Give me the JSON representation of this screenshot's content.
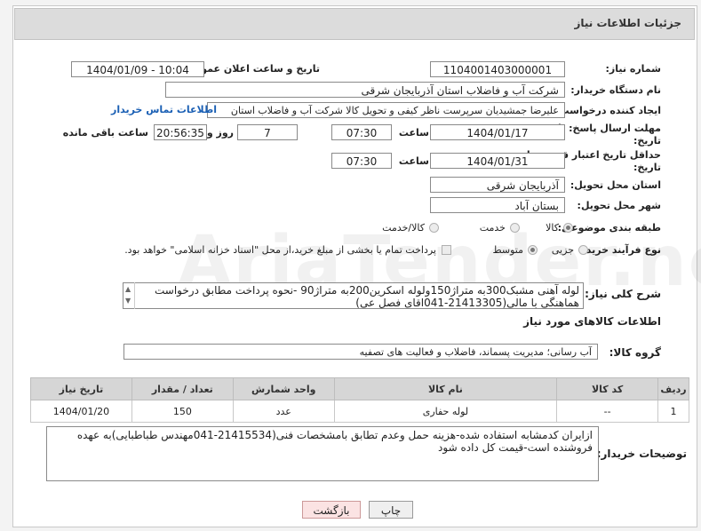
{
  "title": "جزئیات اطلاعات نیاز",
  "watermark": "AriaTender.net",
  "need_number": {
    "label": "شماره نیاز:",
    "value": "1104001403000001"
  },
  "announce": {
    "label": "تاریخ و ساعت اعلان عمومی:",
    "value": "1404/01/09 - 10:04"
  },
  "buyer_org": {
    "label": "نام دستگاه خریدار:",
    "value": "شرکت آب و فاضلاب استان آذربایجان شرقی"
  },
  "creator": {
    "label": "ایجاد کننده درخواست:",
    "value": "علیرضا جمشیدیان سرپرست ناظر کیفی و تحویل کالا شرکت آب و فاضلاب استان",
    "contact_link": "اطلاعات تماس خریدار"
  },
  "deadline": {
    "label_1": "مهلت ارسال پاسخ: تا",
    "label_2": "تاریخ:",
    "date": "1404/01/17",
    "time_label": "ساعت",
    "time": "07:30",
    "days": "7",
    "days_label": "روز و",
    "remaining": "20:56:35",
    "remaining_label": "ساعت باقی مانده"
  },
  "validity": {
    "label_1": "حداقل تاریخ اعتبار قیمت: تا",
    "label_2": "تاریخ:",
    "date": "1404/01/31",
    "time_label": "ساعت",
    "time": "07:30"
  },
  "province": {
    "label": "استان محل تحویل:",
    "value": "آذربایجان شرقی"
  },
  "city": {
    "label": "شهر محل تحویل:",
    "value": "بستان آباد"
  },
  "category": {
    "label": "طبقه بندی موضوعی:",
    "options": [
      "کالا",
      "خدمت",
      "کالا/خدمت"
    ],
    "selected": "کالا"
  },
  "process": {
    "label": "نوع فرآیند خرید :",
    "options": [
      "جزیی",
      "متوسط"
    ],
    "selected": "متوسط",
    "note": "پرداخت تمام یا بخشی از مبلغ خرید،از محل \"اسناد خزانه اسلامی\" خواهد بود."
  },
  "general_desc": {
    "label": "شرح کلی نیاز:",
    "value": "لوله آهنی مشبک300به متراژ150ولوله اسکرین200به متراژ90 -نحوه پرداخت مطابق درخواست هماهنگی با مالی(21413305-041اقای فصل عی)"
  },
  "goods_info_title": "اطلاعات کالاهای مورد نیاز",
  "goods_group": {
    "label": "گروه کالا:",
    "value": "آب رسانی؛ مدیریت پسماند، فاضلاب و فعالیت های تصفیه"
  },
  "table": {
    "headers": [
      "ردیف",
      "کد کالا",
      "نام کالا",
      "واحد شمارش",
      "تعداد / مقدار",
      "تاریخ نیاز"
    ],
    "rows": [
      [
        "1",
        "--",
        "لوله حفاری",
        "عدد",
        "150",
        "1404/01/20"
      ]
    ]
  },
  "buyer_notes": {
    "label": "توضیحات خریدار:",
    "value": "ازایران کدمشابه استفاده شده-هزینه حمل وعدم تطابق بامشخصات فنی(21415534-041مهندس طباطبایی)به عهده فروشنده است-قیمت کل داده شود"
  },
  "buttons": {
    "print": "چاپ",
    "back": "بازگشت"
  }
}
